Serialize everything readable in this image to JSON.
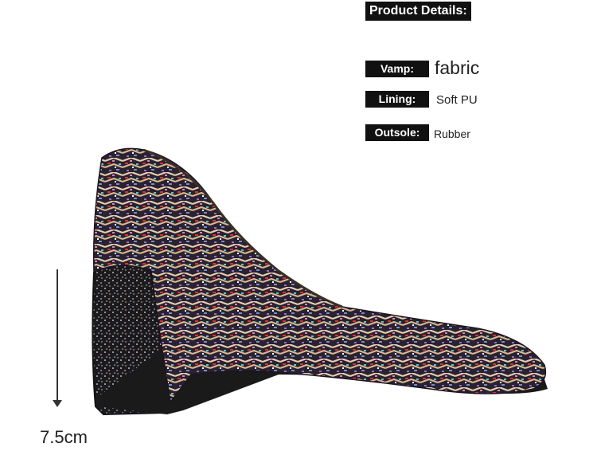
{
  "header": {
    "title": "Product Details:"
  },
  "specs": [
    {
      "label": "Vamp:",
      "value": "fabric"
    },
    {
      "label": "Lining:",
      "value": "Soft PU"
    },
    {
      "label": "Outsole:",
      "value": "Rubber"
    }
  ],
  "heel": {
    "height": "7.5cm"
  },
  "colors": {
    "label_bg": "#111111",
    "label_text": "#ffffff"
  }
}
